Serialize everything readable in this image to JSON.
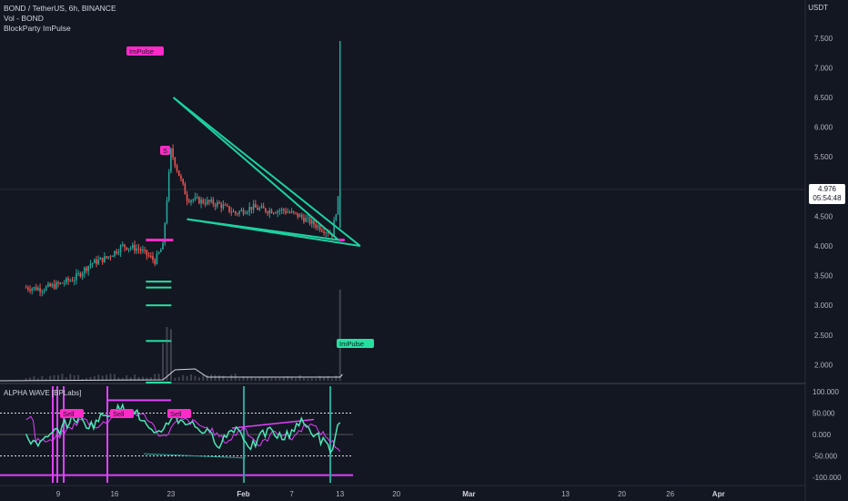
{
  "header": {
    "symbol_line": "BOND / TetherUS, 6h, BINANCE",
    "volume_line": "Vol - BOND",
    "indicator_line": "BlockParty ImPulse",
    "currency": "USDT"
  },
  "oscillator": {
    "title": "ALPHA WAVE [BPLabs]"
  },
  "price_tag": {
    "price": "4.976",
    "countdown": "05:54:48"
  },
  "colors": {
    "background": "#131722",
    "up": "#26a69a",
    "down": "#ef5350",
    "wave": "#4ee6b6",
    "signal": "#e040fb",
    "impulse_tag": "#ff2bc8",
    "impulse_tag_green": "#26e0a0"
  },
  "chart_data": [
    {
      "type": "line",
      "title": "BOND / TetherUS, 6h, BINANCE",
      "ylabel": "USDT",
      "y_ticks": [
        "7.500",
        "7.000",
        "6.500",
        "6.000",
        "5.500",
        "5.000",
        "4.500",
        "4.000",
        "3.500",
        "3.000",
        "2.500",
        "2.000"
      ],
      "x_ticks": [
        "9",
        "16",
        "23",
        "Feb",
        "7",
        "13",
        "20",
        "Mar",
        "13",
        "20",
        "26",
        "Apr"
      ],
      "ylim": [
        1.8,
        7.8
      ],
      "series": [
        {
          "x": [
            "Jan 5",
            "Jan 7",
            "Jan 9",
            "Jan 11",
            "Jan 13",
            "Jan 15",
            "Jan 17",
            "Jan 19",
            "Jan 21",
            "Jan 22",
            "Jan 23",
            "Jan 25",
            "Jan 27",
            "Jan 29",
            "Jan 31",
            "Feb 2",
            "Feb 4",
            "Feb 6",
            "Feb 8",
            "Feb 10",
            "Feb 12",
            "Feb 13"
          ],
          "values": [
            3.3,
            3.28,
            3.35,
            3.45,
            3.7,
            3.8,
            4.0,
            3.95,
            3.75,
            4.0,
            5.6,
            4.8,
            4.75,
            4.7,
            4.55,
            4.65,
            4.6,
            4.6,
            4.5,
            4.35,
            4.2,
            4.97
          ]
        }
      ],
      "annotations": [
        "ImPulse",
        "S",
        "ImPulse"
      ],
      "last_price": 4.976
    },
    {
      "type": "line",
      "title": "ALPHA WAVE [BPLabs]",
      "y_ticks": [
        "100.000",
        "50.000",
        "0.000",
        "-50.000",
        "-100.000"
      ],
      "ylim": [
        -110,
        110
      ],
      "series": [
        {
          "x": [
            "Jan 5",
            "Jan 7",
            "Jan 9",
            "Jan 11",
            "Jan 13",
            "Jan 15",
            "Jan 17",
            "Jan 19",
            "Jan 21",
            "Jan 23",
            "Jan 25",
            "Jan 27",
            "Jan 29",
            "Jan 31",
            "Feb 2",
            "Feb 4",
            "Feb 6",
            "Feb 8",
            "Feb 10",
            "Feb 12",
            "Feb 13"
          ],
          "values": [
            -10,
            -20,
            10,
            40,
            20,
            50,
            60,
            45,
            -10,
            40,
            30,
            10,
            -20,
            20,
            -30,
            10,
            -10,
            30,
            0,
            -40,
            40
          ]
        }
      ],
      "annotations": [
        "Sell",
        "Sell",
        "Sell"
      ]
    }
  ]
}
